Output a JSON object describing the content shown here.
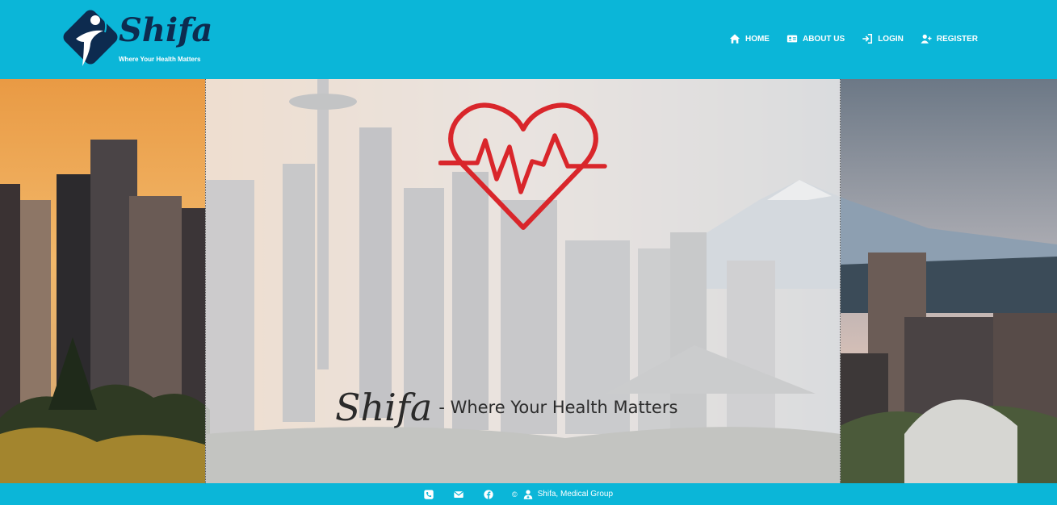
{
  "brand": {
    "name": "Shifa",
    "tagline": "Where Your Health Matters"
  },
  "nav": {
    "items": [
      {
        "label": "HOME",
        "icon": "home-icon"
      },
      {
        "label": "ABOUT US",
        "icon": "id-card-icon"
      },
      {
        "label": "LOGIN",
        "icon": "login-icon"
      },
      {
        "label": "REGISTER",
        "icon": "user-plus-icon"
      }
    ]
  },
  "hero": {
    "brand": "Shifa",
    "tagline": "- Where Your Health Matters",
    "image": "city-skyline-with-mountain-photo",
    "emblem": "heartbeat-heart-icon"
  },
  "footer": {
    "icons": [
      "phone-icon",
      "email-icon",
      "facebook-icon"
    ],
    "copyright": "©",
    "org_icon": "user-doctor-icon",
    "org": "Shifa, Medical Group"
  },
  "colors": {
    "primary": "#0bb6d8",
    "logo_navy": "#0d2b4f",
    "heart_red": "#d9262b",
    "overlay": "#eeeeee"
  }
}
